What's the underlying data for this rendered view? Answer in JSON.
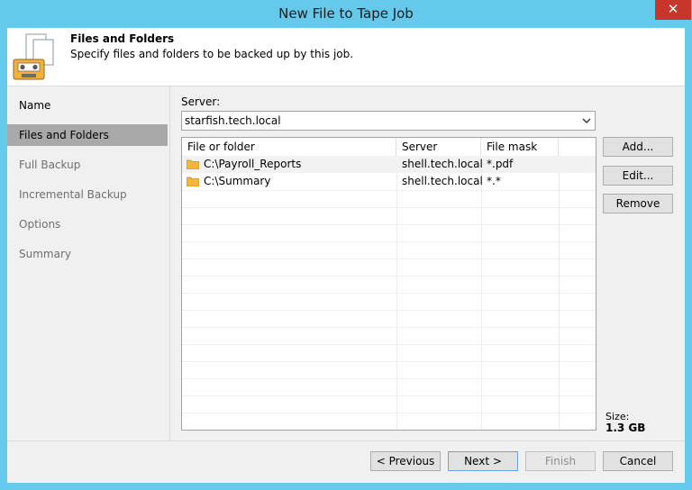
{
  "window": {
    "title": "New File to Tape Job",
    "close_glyph": "✕"
  },
  "header": {
    "title": "Files and Folders",
    "subtitle": "Specify files and folders to be backed up by this job.",
    "icon": "file-tape-icon"
  },
  "nav": {
    "items": [
      {
        "label": "Name",
        "state": "normal"
      },
      {
        "label": "Files and Folders",
        "state": "active"
      },
      {
        "label": "Full Backup",
        "state": "disabled"
      },
      {
        "label": "Incremental Backup",
        "state": "disabled"
      },
      {
        "label": "Options",
        "state": "disabled"
      },
      {
        "label": "Summary",
        "state": "disabled"
      }
    ]
  },
  "server": {
    "label": "Server:",
    "value": "starfish.tech.local",
    "chevron": "chevron-down-icon"
  },
  "table": {
    "columns": [
      "File or folder",
      "Server",
      "File mask"
    ],
    "rows": [
      {
        "path": "C:\\Payroll_Reports",
        "server": "shell.tech.local",
        "mask": "*.pdf",
        "icon": "folder-icon"
      },
      {
        "path": "C:\\Summary",
        "server": "shell.tech.local",
        "mask": "*.*",
        "icon": "folder-icon"
      }
    ]
  },
  "side_buttons": {
    "add": "Add...",
    "edit": "Edit...",
    "remove": "Remove"
  },
  "size": {
    "label": "Size:",
    "value": "1.3 GB"
  },
  "footer": {
    "previous": "< Previous",
    "next": "Next >",
    "finish": "Finish",
    "cancel": "Cancel"
  },
  "colors": {
    "titlebar": "#65c9ec",
    "close": "#c7352b",
    "nav_active": "#a9a9a9",
    "folder": "#f0b73a"
  }
}
